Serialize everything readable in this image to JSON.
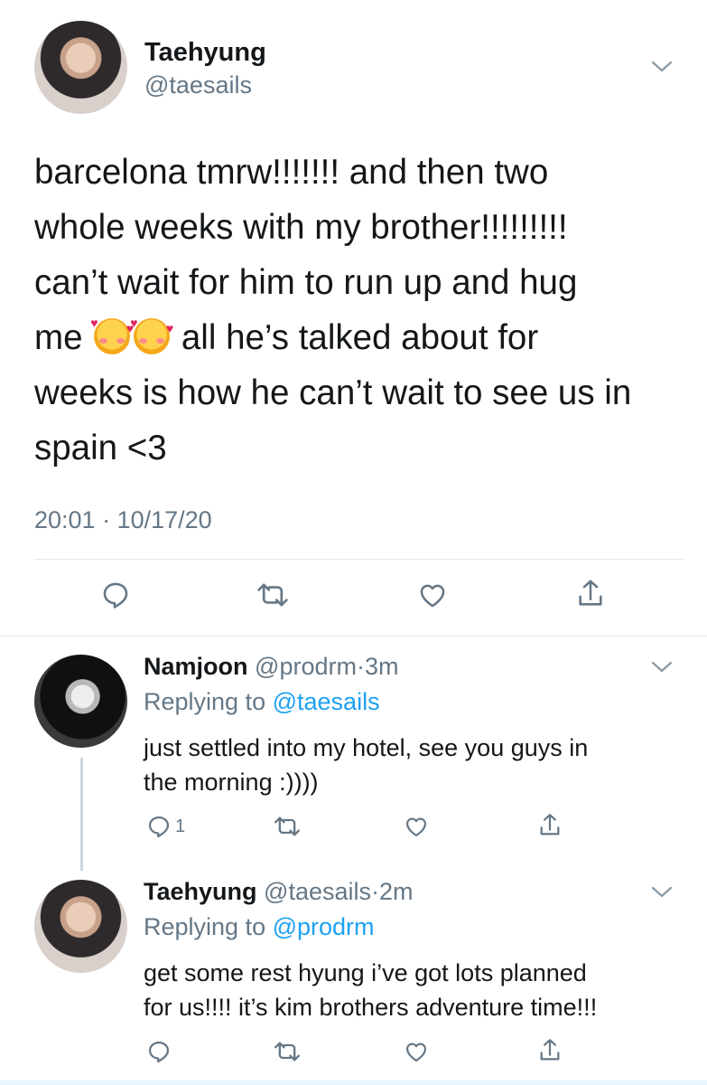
{
  "main_tweet": {
    "display_name": "Taehyung",
    "handle": "@taesails",
    "lines": [
      "barcelona tmrw!!!!!!! and then two",
      "whole weeks with my brother!!!!!!!!!",
      "can’t wait for him to run up and hug",
      "all he’s talked about for",
      "weeks is how he can’t wait to see us in",
      "spain <3"
    ],
    "line4_prefix": "me",
    "emoji": [
      "smiling-face-with-hearts",
      "smiling-face-with-hearts"
    ],
    "timestamp": "20:01 · 10/17/20"
  },
  "replies": [
    {
      "display_name": "Namjoon",
      "handle": "@prodrm",
      "separator": "·",
      "time": "3m",
      "replying_label": "Replying to",
      "replying_to": "@taesails",
      "text_lines": [
        "just settled into my hotel, see you guys in",
        "the morning :))))"
      ],
      "reply_count": "1"
    },
    {
      "display_name": "Taehyung",
      "handle": "@taesails",
      "separator": "·",
      "time": "2m",
      "replying_label": "Replying to",
      "replying_to": "@prodrm",
      "text_lines": [
        "get some rest hyung i’ve got lots planned",
        "for us!!!! it’s kim brothers adventure time!!!"
      ]
    }
  ],
  "colors": {
    "text": "#14171a",
    "secondary": "#657786",
    "link": "#1da1f2",
    "divider": "#e1e8ed"
  },
  "icons": [
    "chevron-down-icon",
    "reply-icon",
    "retweet-icon",
    "like-icon",
    "share-icon"
  ]
}
